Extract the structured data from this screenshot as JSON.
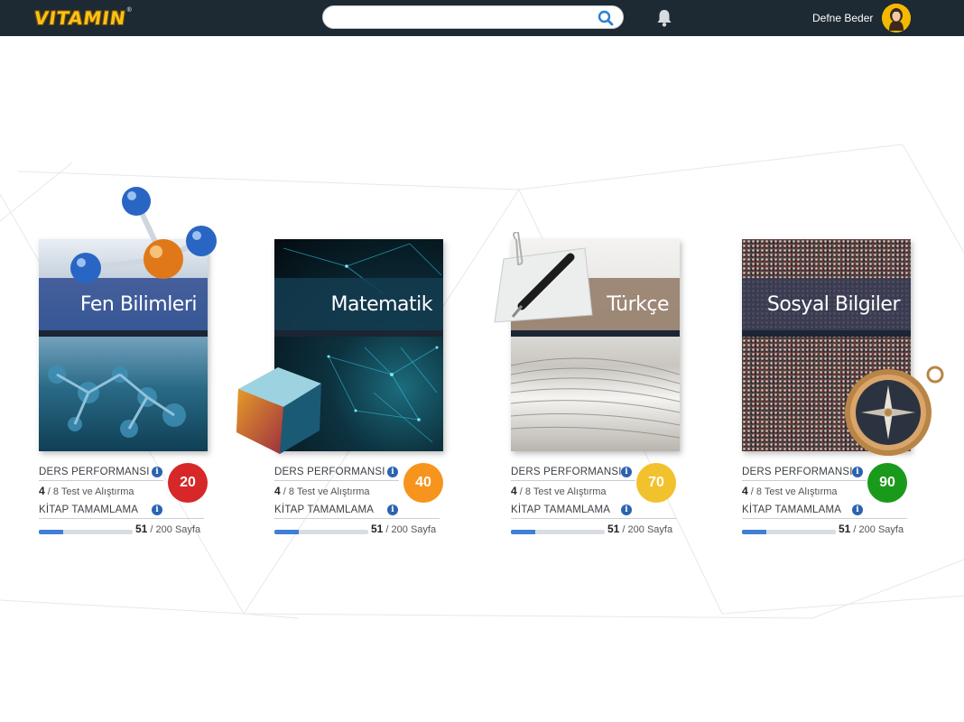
{
  "header": {
    "logo_text": "VITAMIN",
    "logo_mark": "®",
    "search_placeholder": "",
    "user_name": "Defne Beder",
    "icons": [
      "search-icon",
      "bell-icon",
      "avatar"
    ]
  },
  "courses": [
    {
      "title": "Fen Bilimleri",
      "performance_label": "DERS PERFORMANSI",
      "score": "20",
      "score_color": "#d62828",
      "tests_done": "4",
      "tests_total_text": "/ 8 Test ve Alıştırma",
      "completion_label": "KİTAP TAMAMLAMA",
      "pages_done": "51",
      "pages_total_text": "/ 200 Sayfa",
      "progress": 0.255,
      "cover_theme": "molecule"
    },
    {
      "title": "Matematik",
      "performance_label": "DERS PERFORMANSI",
      "score": "40",
      "score_color": "#f7941d",
      "tests_done": "4",
      "tests_total_text": "/ 8 Test ve Alıştırma",
      "completion_label": "KİTAP TAMAMLAMA",
      "pages_done": "51",
      "pages_total_text": "/ 200 Sayfa",
      "progress": 0.255,
      "cover_theme": "network"
    },
    {
      "title": "Türkçe",
      "performance_label": "DERS PERFORMANSI",
      "score": "70",
      "score_color": "#f2c12e",
      "tests_done": "4",
      "tests_total_text": "/ 8 Test ve Alıştırma",
      "completion_label": "KİTAP TAMAMLAMA",
      "pages_done": "51",
      "pages_total_text": "/ 200 Sayfa",
      "progress": 0.255,
      "cover_theme": "book"
    },
    {
      "title": "Sosyal Bilgiler",
      "performance_label": "DERS PERFORMANSI",
      "score": "90",
      "score_color": "#1a9a1a",
      "tests_done": "4",
      "tests_total_text": "/ 8 Test ve Alıştırma",
      "completion_label": "KİTAP TAMAMLAMA",
      "pages_done": "51",
      "pages_total_text": "/ 200 Sayfa",
      "progress": 0.255,
      "cover_theme": "crowd"
    }
  ]
}
